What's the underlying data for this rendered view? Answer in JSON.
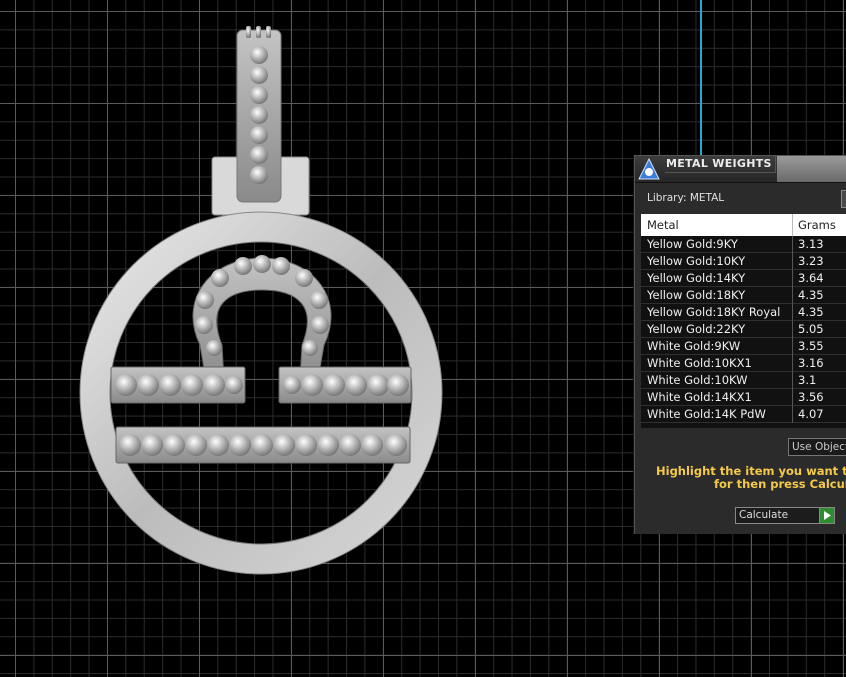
{
  "panel": {
    "title": "METAL WEIGHTS",
    "library_label": "Library: METAL",
    "columns": [
      "Metal",
      "Grams"
    ],
    "rows": [
      {
        "metal": "Yellow Gold:9KY",
        "grams": "3.13"
      },
      {
        "metal": "Yellow Gold:10KY",
        "grams": "3.23"
      },
      {
        "metal": "Yellow Gold:14KY",
        "grams": "3.64"
      },
      {
        "metal": "Yellow Gold:18KY",
        "grams": "4.35"
      },
      {
        "metal": "Yellow Gold:18KY Royal",
        "grams": "4.35"
      },
      {
        "metal": "Yellow Gold:22KY",
        "grams": "5.05"
      },
      {
        "metal": "White Gold:9KW",
        "grams": "3.55"
      },
      {
        "metal": "White Gold:10KX1",
        "grams": "3.16"
      },
      {
        "metal": "White Gold:10KW",
        "grams": "3.1"
      },
      {
        "metal": "White Gold:14KX1",
        "grams": "3.56"
      },
      {
        "metal": "White Gold:14K PdW",
        "grams": "4.07"
      }
    ],
    "use_object_label": "Use Object",
    "instruction_line1": "Highlight the item you want to find",
    "instruction_line2": "for then press Calculate",
    "calculate_label": "Calculate"
  },
  "colors": {
    "background": "#000000",
    "grid_major": "#5a5a5a",
    "grid_minor": "#2c2c2c",
    "axis_line": "#2aa6d6",
    "instruction_text": "#f5c94a",
    "go_button": "#2f8c2f"
  },
  "icons": {
    "panel_icon": "metal-weights-icon",
    "go_icon": "play-arrow-icon"
  }
}
